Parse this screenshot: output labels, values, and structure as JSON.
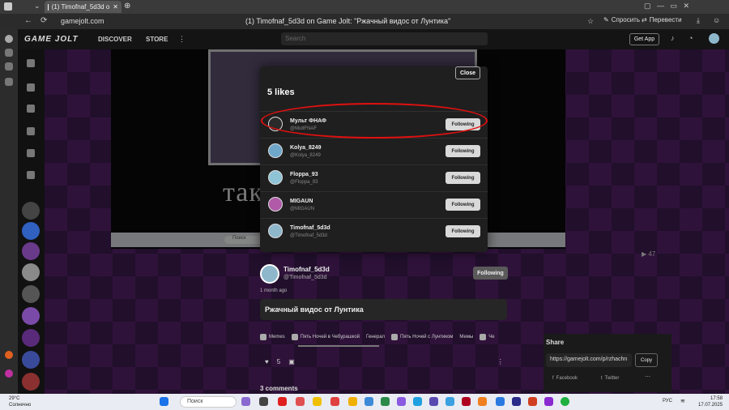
{
  "browser": {
    "tab_title": "(1) Timofnaf_5d3d о",
    "url": "gamejolt.com",
    "page_title": "(1) Timofnaf_5d3d on Game Jolt: \"Ржачный видос от Лунтика\"",
    "ask_label": "Спросить",
    "translate_label": "Перевести"
  },
  "gj_header": {
    "logo": "GAME JOLT",
    "discover": "DISCOVER",
    "store": "STORE",
    "search_placeholder": "Search",
    "get_app": "Get App"
  },
  "video": {
    "overlay_text": "так         Луне",
    "taskbar_search": "Поиск",
    "view_count": "47"
  },
  "post": {
    "author_name": "Timofnaf_5d3d",
    "author_handle": "@Timofnaf_5d3d",
    "follow_label": "Following",
    "time": "1 month ago",
    "title": "Ржачный видос от Лунтика",
    "tags": [
      "Memes",
      "Пять Ночей в Чебурашкой",
      "Генерал",
      "Пять Ночей с Лунтиком",
      "Мемы",
      "Че"
    ],
    "like_count": "5",
    "comments": "3 comments"
  },
  "likes_modal": {
    "close": "Close",
    "title": "5 likes",
    "users": [
      {
        "name": "Мульт ФНАФ",
        "handle": "@MultFNAF",
        "button": "Following",
        "color": "#2a2a2a"
      },
      {
        "name": "Kolya_8249",
        "handle": "@Kolya_8249",
        "button": "Following",
        "color": "#6ea7c9"
      },
      {
        "name": "Floppa_93",
        "handle": "@Floppa_93",
        "button": "Following",
        "color": "#8fc3d6"
      },
      {
        "name": "MIGAUN",
        "handle": "@MIGAUN",
        "button": "Following",
        "color": "#b05aa8"
      },
      {
        "name": "Timofnaf_5d3d",
        "handle": "@Timofnaf_5d3d",
        "button": "Following",
        "color": "#8fb7cc"
      }
    ]
  },
  "share": {
    "title": "Share",
    "url": "https://gamejolt.com/p/rzhachn",
    "copy": "Copy",
    "facebook": "Facebook",
    "twitter": "Twitter"
  },
  "taskbar": {
    "weather_temp": "29°C",
    "weather_desc": "Солнечно",
    "search": "Поиск",
    "lang": "РУС",
    "time": "17:58",
    "date": "17.07.2025"
  }
}
